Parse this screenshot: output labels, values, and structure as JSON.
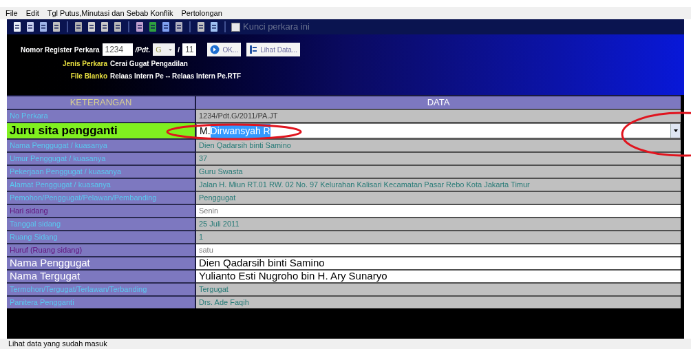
{
  "menu": [
    "File",
    "Edit",
    "Tgl Putus,Minutasi dan Sebab Konflik",
    "Pertolongan"
  ],
  "toolbar": {
    "lock": {
      "label": "Kunci perkara ini",
      "checked": false,
      "disabled": true
    }
  },
  "register": {
    "label": "Nomor Register Perkara",
    "number": "1234",
    "pdt": "/Pdt.",
    "type": "G",
    "slash": "/",
    "year": "11",
    "ok": "OK...",
    "view": "Lihat Data..."
  },
  "info": [
    {
      "label": "Jenis Perkara",
      "value": "Cerai Gugat Pengadilan"
    },
    {
      "label": "File Blanko",
      "value": "Relaas Intern Pe -- Relaas Intern Pe.RTF"
    }
  ],
  "table": {
    "columns": [
      "KETERANGAN",
      "DATA"
    ],
    "rows": [
      {
        "label": {
          "text": "No Perkara",
          "kind": "small"
        },
        "value": {
          "text": "1234/Pdt.G/2011/PA.JT",
          "kind": "faint"
        }
      },
      {
        "label": {
          "text": "Juru sita pengganti",
          "kind": "focus"
        },
        "value": {
          "text": "M.",
          "selection": "Dirwansyah R",
          "kind": "combo"
        }
      },
      {
        "label": {
          "text": "Nama Penggugat / kuasanya",
          "kind": "small"
        },
        "value": {
          "text": "Dien Qadarsih binti Samino",
          "kind": "readonly"
        }
      },
      {
        "label": {
          "text": "Umur Penggugat / kuasanya",
          "kind": "small"
        },
        "value": {
          "text": "37",
          "kind": "readonly"
        }
      },
      {
        "label": {
          "text": "Pekerjaan Penggugat / kuasanya",
          "kind": "small"
        },
        "value": {
          "text": "Guru Swasta",
          "kind": "readonly"
        }
      },
      {
        "label": {
          "text": "Alamat Penggugat / kuasanya",
          "kind": "small"
        },
        "value": {
          "text": "Jalan H. Miun RT.01 RW. 02 No. 97  Kelurahan Kalisari Kecamatan Pasar Rebo Kota Jakarta Timur",
          "kind": "readonly"
        }
      },
      {
        "label": {
          "text": "Pemohon/Penggugat/Pelawan/Pembanding",
          "kind": "small"
        },
        "value": {
          "text": "Penggugat",
          "kind": "readonly"
        }
      },
      {
        "label": {
          "text": "Hari sidang",
          "kind": "dim"
        },
        "value": {
          "text": "Senin",
          "kind": "plain"
        }
      },
      {
        "label": {
          "text": "Tanggal sidang",
          "kind": "small"
        },
        "value": {
          "text": "25 Juli 2011",
          "kind": "readonly"
        }
      },
      {
        "label": {
          "text": "Ruang Sidang",
          "kind": "small"
        },
        "value": {
          "text": "1",
          "kind": "readonly"
        }
      },
      {
        "label": {
          "text": "Huruf (Ruang sidang)",
          "kind": "dim"
        },
        "value": {
          "text": "satu",
          "kind": "plain"
        }
      },
      {
        "label": {
          "text": "Nama Penggugat",
          "kind": "large"
        },
        "value": {
          "text": "Dien Qadarsih binti Samino",
          "kind": "input"
        }
      },
      {
        "label": {
          "text": "Nama Tergugat",
          "kind": "large"
        },
        "value": {
          "text": "Yulianto Esti Nugroho bin H. Ary Sunaryo",
          "kind": "input"
        }
      },
      {
        "label": {
          "text": "Termohon/Tergugat/Terlawan/Terbanding",
          "kind": "small"
        },
        "value": {
          "text": "Tergugat",
          "kind": "readonly"
        }
      },
      {
        "label": {
          "text": "Panitera Pengganti",
          "kind": "small"
        },
        "value": {
          "text": "Drs. Ade Faqih",
          "kind": "readonly"
        }
      }
    ]
  },
  "status_bar": "Lihat data yang sudah masuk"
}
